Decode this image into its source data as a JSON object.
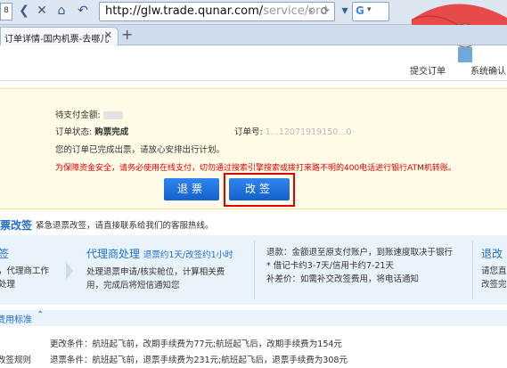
{
  "browser": {
    "url_main": "http://glw.trade.qunar.com/",
    "url_dim": "service/ord",
    "tab_title": "订单详情-国内机票-去哪儿",
    "tab_left_fragment": "8"
  },
  "header": {
    "links": [
      "提交订单",
      "系统确认"
    ]
  },
  "order": {
    "amount_label": "待支付金额:",
    "status_label": "订单状态:",
    "status_value": "购票完成",
    "order_no_label": "订单号:",
    "order_no_value": "1...12071919150...0",
    "completed_msg": "您的订单已完成出票，请放心安排出行计划。",
    "warning": "为保障资金安全，请务必使用在线支付，切勿通过搜索引擎搜索或拨打来路不明的400电话进行银行ATM机转账。",
    "refund_button": "退票",
    "change_button": "改签"
  },
  "refund": {
    "title": "票改签",
    "note": "紧急退票改签，请直接联系给我们的客服热线。"
  },
  "steps": [
    {
      "title": "签",
      "lines": [
        "，代理商工作",
        "处理"
      ]
    },
    {
      "title": "代理商处理",
      "subtitle": "退票约1天/改签约1小时",
      "lines": [
        "处理退票申请/核实舱位，计算相关费",
        "用，完成后将短信通知您"
      ]
    },
    {
      "title": "",
      "lines": [
        "退款：金额退至原支付账户，到账速度取决于银行",
        "* 借记卡约3-7天/信用卡约7-21天",
        "补差价：如需补交改签费用，将电话通知"
      ]
    },
    {
      "title": "退改",
      "lines": [
        "请您直",
        "改签完"
      ]
    }
  ],
  "fees": {
    "title": "费用标准",
    "left_label": "改签规则",
    "lines": [
      "更改条件：航班起飞前，改期手续费为77元;航班起飞后，改期手续费为154元",
      "退票条件：航班起飞前，退票手续费为231元;航班起飞后，退票手续费为308元"
    ]
  },
  "colors": {
    "accent": "#1f6fd1",
    "warning": "#e00000",
    "highlight": "#e00000"
  }
}
